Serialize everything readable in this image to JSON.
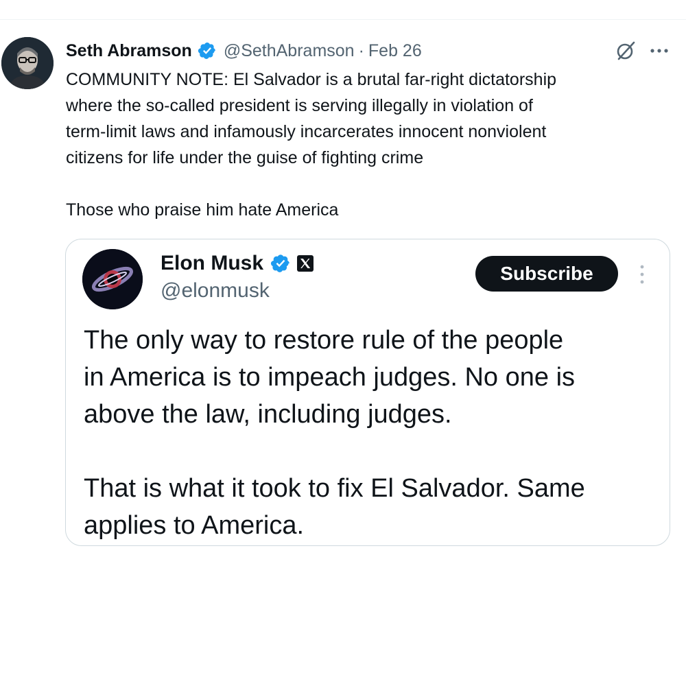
{
  "tweet": {
    "author": {
      "name": "Seth Abramson",
      "handle": "@SethAbramson",
      "verified": true
    },
    "separator": "·",
    "date": "Feb 26",
    "text": "COMMUNITY NOTE: El Salvador is a brutal far-right dictatorship\nwhere the so-called president is serving illegally in violation of\nterm-limit laws and infamously incarcerates innocent nonviolent\ncitizens for life under the guise of fighting crime\n\nThose who praise him hate America",
    "icons": {
      "grok": "grok-icon",
      "more": "more-horizontal-icon"
    }
  },
  "quoted_tweet": {
    "author": {
      "name": "Elon Musk",
      "handle": "@elonmusk",
      "verified": true,
      "affiliate_badge": "x-logo-icon"
    },
    "subscribe_label": "Subscribe",
    "text": "The only way to restore rule of the people\nin America is to impeach judges. No one is\nabove the law, including judges.\n\nThat is what it took to fix El Salvador. Same\napplies to America.",
    "icons": {
      "more": "more-vertical-icon"
    }
  },
  "colors": {
    "verified_blue": "#1d9bf0",
    "text_primary": "#0f1419",
    "text_secondary": "#536471",
    "border": "#cfd9de",
    "button_bg": "#0f1419"
  }
}
